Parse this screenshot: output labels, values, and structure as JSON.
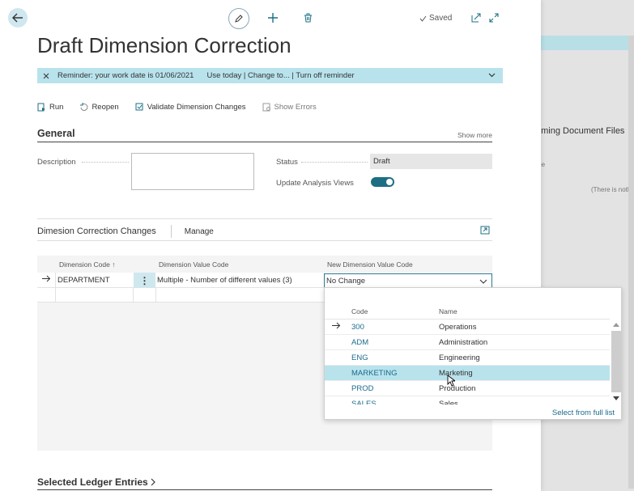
{
  "background_page": {
    "title": "oming Document Files",
    "subtitle": "me",
    "empty_text": "(There is nothi"
  },
  "toolbar": {
    "saved_label": "Saved"
  },
  "page": {
    "title": "Draft Dimension Correction"
  },
  "reminder": {
    "message": "Reminder: your work date is 01/06/2021",
    "actions": "Use today | Change to... | Turn off reminder"
  },
  "actions": {
    "run": "Run",
    "reopen": "Reopen",
    "validate": "Validate Dimension Changes",
    "show_errors": "Show Errors"
  },
  "general": {
    "title": "General",
    "show_more": "Show more",
    "description_label": "Description",
    "description_value": "",
    "status_label": "Status",
    "status_value": "Draft",
    "update_analysis_label": "Update Analysis Views",
    "update_analysis_on": true
  },
  "changes": {
    "title": "Dimesion Correction Changes",
    "manage": "Manage",
    "columns": {
      "dimension_code": "Dimension Code ↑",
      "dimension_value_code": "Dimension Value Code",
      "new_dimension_value_code": "New Dimension Value Code"
    },
    "rows": [
      {
        "dimension_code": "DEPARTMENT",
        "dimension_value_code": "Multiple - Number of different values (3)",
        "new_dimension_value_code": "No Change"
      }
    ]
  },
  "lookup": {
    "columns": {
      "code": "Code",
      "name": "Name"
    },
    "rows": [
      {
        "code": "300",
        "name": "Operations"
      },
      {
        "code": "ADM",
        "name": "Administration"
      },
      {
        "code": "ENG",
        "name": "Engineering"
      },
      {
        "code": "MARKETING",
        "name": "Marketing"
      },
      {
        "code": "PROD",
        "name": "Production"
      },
      {
        "code": "SALES",
        "name": "Sales"
      }
    ],
    "current_row": 0,
    "selected_row": 3,
    "footer_link": "Select from full list"
  },
  "ledger": {
    "title": "Selected Ledger Entries"
  },
  "colors": {
    "accent": "#1c6f83",
    "reminder_bg": "#b9e3ec",
    "link": "#1b6b8c"
  }
}
